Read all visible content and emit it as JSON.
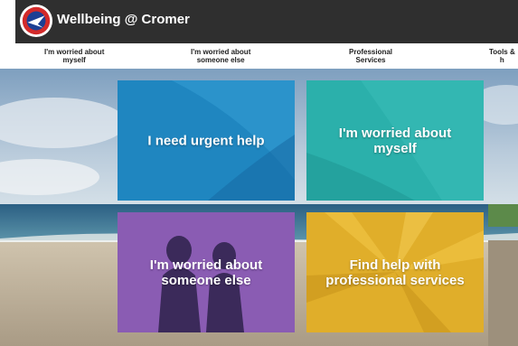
{
  "header": {
    "title": "Wellbeing @ Cromer",
    "logo_icon": "school-crest-icon"
  },
  "nav": {
    "items": [
      {
        "label_1": "I'm worried about",
        "label_2": "myself"
      },
      {
        "label_1": "I'm worried about",
        "label_2": "someone else"
      },
      {
        "label_1": "Professional",
        "label_2": "Services"
      },
      {
        "label_1": "Tools &",
        "label_2": "h"
      }
    ]
  },
  "tiles": [
    {
      "label": "I need urgent help",
      "color": "#1f86c0"
    },
    {
      "label": "I'm worried about myself",
      "color": "#2bb0ab"
    },
    {
      "label": "I'm worried about someone else",
      "color": "#8a5cb3"
    },
    {
      "label": "Find help with professional services",
      "color": "#e0ae2a"
    }
  ]
}
